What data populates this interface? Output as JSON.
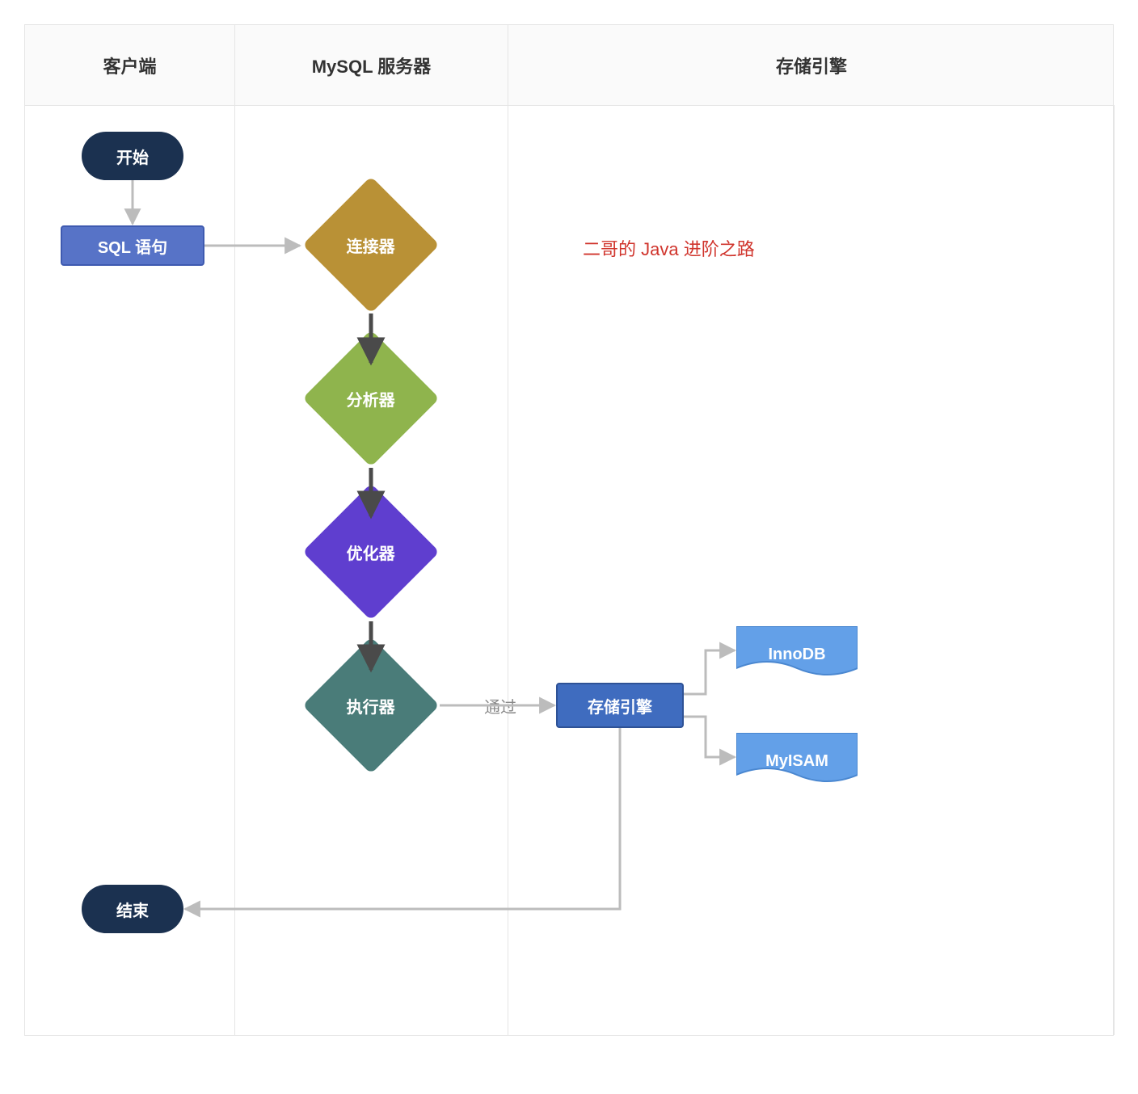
{
  "lanes": {
    "client": "客户端",
    "server": "MySQL 服务器",
    "engine": "存储引擎"
  },
  "nodes": {
    "start": "开始",
    "sql": "SQL 语句",
    "connector": "连接器",
    "analyzer": "分析器",
    "optimizer": "优化器",
    "executor": "执行器",
    "storage": "存储引擎",
    "innodb": "InnoDB",
    "myisam": "MyISAM",
    "end": "结束"
  },
  "labels": {
    "through": "通过"
  },
  "note": "二哥的 Java 进阶之路",
  "colors": {
    "dark_blue": "#1b3150",
    "blue": "#5773c7",
    "blue_light": "#5a87ce",
    "ochre": "#b99136",
    "green": "#8fb44d",
    "purple": "#5f3ecf",
    "teal": "#4a7c79",
    "flag_blue": "#3f6cbf",
    "flag_light": "#63a0e8",
    "arrow_light": "#bcbcbc",
    "arrow_dark": "#4a4a4a"
  }
}
